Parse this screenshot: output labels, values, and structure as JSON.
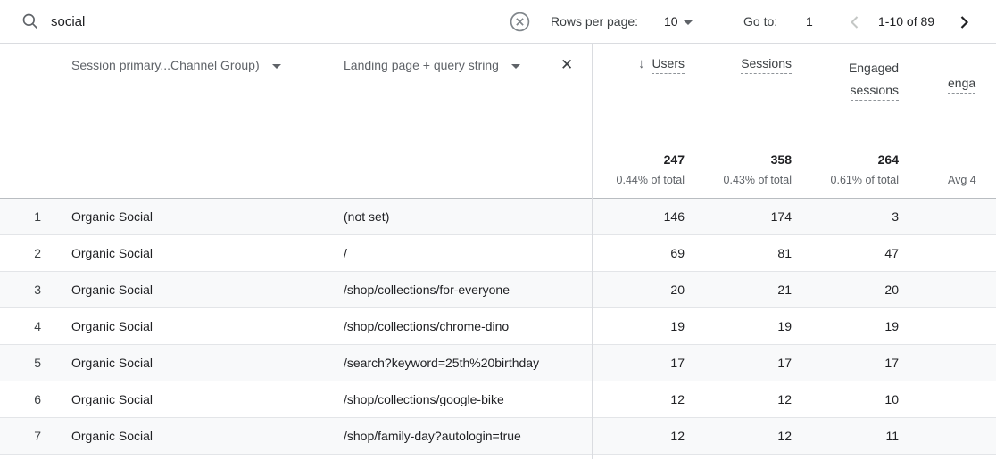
{
  "topbar": {
    "search": {
      "value": "social"
    },
    "rows_per_page": {
      "label": "Rows per page:",
      "value": "10"
    },
    "go_to": {
      "label": "Go to:",
      "value": "1"
    },
    "pagination": {
      "range": "1-10 of 89"
    }
  },
  "table": {
    "dimension_headers": [
      {
        "label": "Session primary...Channel Group)"
      },
      {
        "label": "Landing page + query string"
      }
    ],
    "metric_headers": [
      {
        "label": "Users",
        "sorted": "desc"
      },
      {
        "label": "Sessions"
      },
      {
        "label_line1": "Engaged",
        "label_line2": "sessions"
      },
      {
        "label": "enga"
      }
    ],
    "totals": {
      "users": {
        "value": "247",
        "share": "0.44% of total"
      },
      "sessions": {
        "value": "358",
        "share": "0.43% of total"
      },
      "engaged_sessions": {
        "value": "264",
        "share": "0.61% of total"
      },
      "extra": {
        "share": "Avg 4"
      }
    },
    "rows": [
      {
        "index": "1",
        "channel": "Organic Social",
        "landing_page": "(not set)",
        "users": "146",
        "sessions": "174",
        "engaged_sessions": "3"
      },
      {
        "index": "2",
        "channel": "Organic Social",
        "landing_page": "/",
        "users": "69",
        "sessions": "81",
        "engaged_sessions": "47"
      },
      {
        "index": "3",
        "channel": "Organic Social",
        "landing_page": "/shop/collections/for-everyone",
        "users": "20",
        "sessions": "21",
        "engaged_sessions": "20"
      },
      {
        "index": "4",
        "channel": "Organic Social",
        "landing_page": "/shop/collections/chrome-dino",
        "users": "19",
        "sessions": "19",
        "engaged_sessions": "19"
      },
      {
        "index": "5",
        "channel": "Organic Social",
        "landing_page": "/search?keyword=25th%20birthday",
        "users": "17",
        "sessions": "17",
        "engaged_sessions": "17"
      },
      {
        "index": "6",
        "channel": "Organic Social",
        "landing_page": "/shop/collections/google-bike",
        "users": "12",
        "sessions": "12",
        "engaged_sessions": "10"
      },
      {
        "index": "7",
        "channel": "Organic Social",
        "landing_page": "/shop/family-day?autologin=true",
        "users": "12",
        "sessions": "12",
        "engaged_sessions": "11"
      }
    ]
  }
}
